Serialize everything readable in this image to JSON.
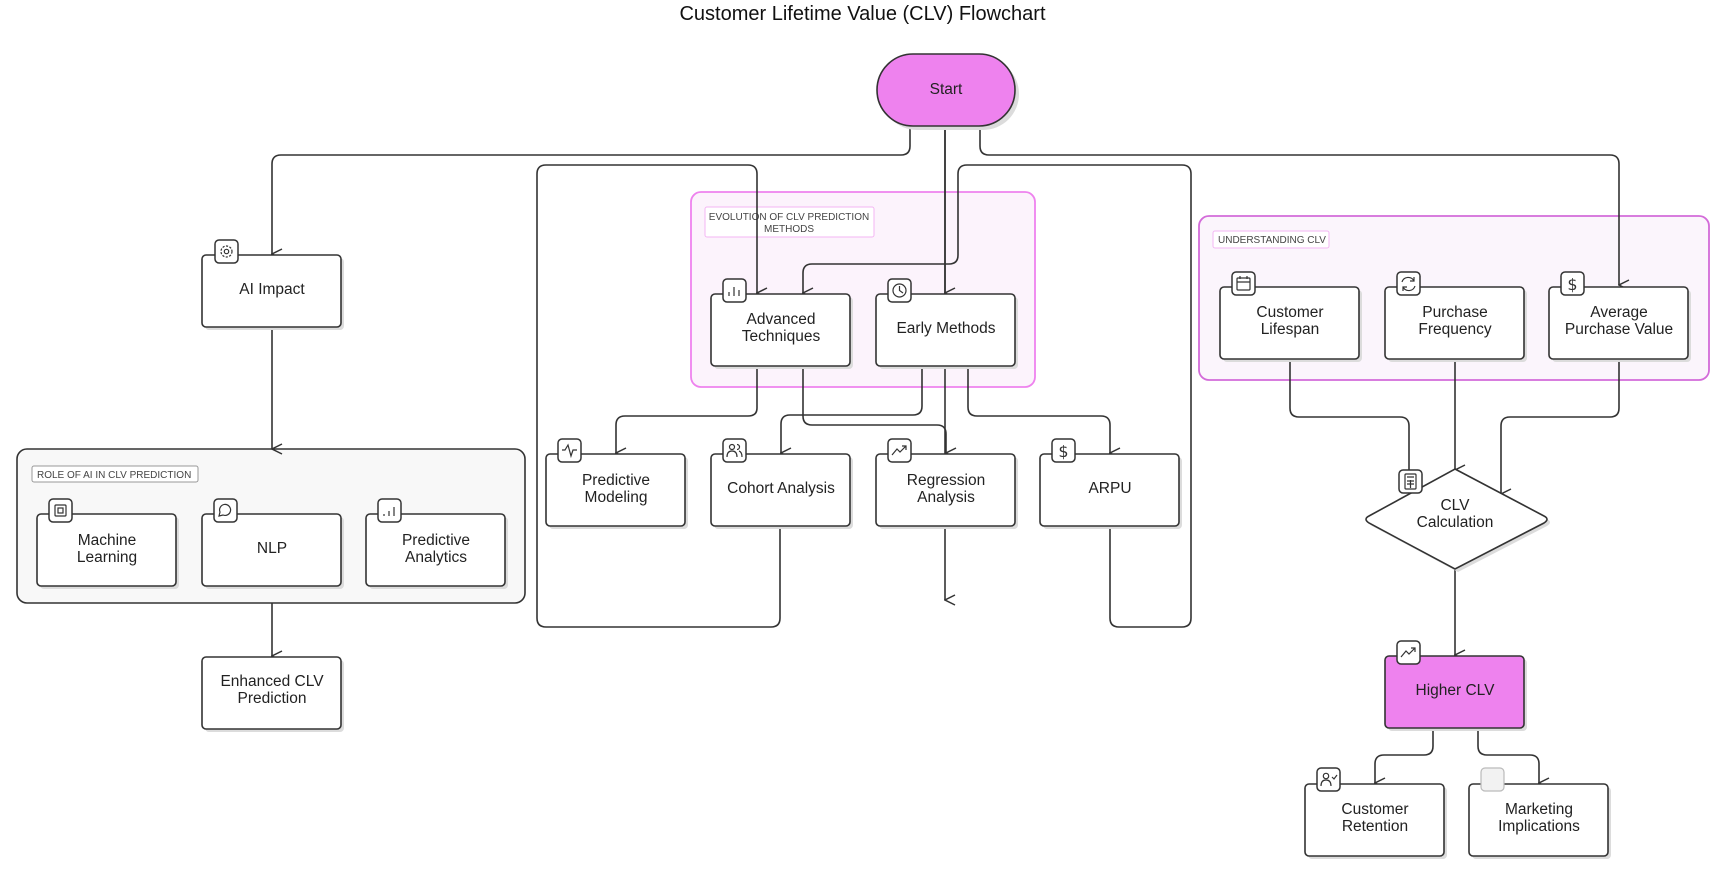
{
  "title": "Customer Lifetime Value (CLV) Flowchart",
  "colors": {
    "highlight": "#ee82ee",
    "group_border_pink": "#ee82ee",
    "group_fill_pink": "#fcf3fc",
    "stroke": "#333333"
  },
  "groups": {
    "role_of_ai": {
      "label": "ROLE OF AI IN CLV PREDICTION"
    },
    "evolution": {
      "label_line1": "EVOLUTION OF CLV PREDICTION",
      "label_line2": "METHODS"
    },
    "understanding": {
      "label": "UNDERSTANDING CLV"
    }
  },
  "nodes": {
    "start": {
      "label": "Start"
    },
    "ai_impact": {
      "label": "AI Impact",
      "icon": "gear-icon"
    },
    "machine_learning": {
      "line1": "Machine",
      "line2": "Learning",
      "icon": "cpu-icon"
    },
    "nlp": {
      "label": "NLP",
      "icon": "chat-bubble-icon"
    },
    "predictive_analytics": {
      "line1": "Predictive",
      "line2": "Analytics",
      "icon": "bar-chart-icon"
    },
    "enhanced_clv": {
      "line1": "Enhanced CLV",
      "line2": "Prediction"
    },
    "advanced_techniques": {
      "line1": "Advanced",
      "line2": "Techniques",
      "icon": "bar-chart-icon"
    },
    "early_methods": {
      "label": "Early Methods",
      "icon": "clock-icon"
    },
    "predictive_modeling": {
      "line1": "Predictive",
      "line2": "Modeling",
      "icon": "activity-icon"
    },
    "cohort_analysis": {
      "label": "Cohort Analysis",
      "icon": "users-icon"
    },
    "regression_analysis": {
      "line1": "Regression",
      "line2": "Analysis",
      "icon": "trending-up-icon"
    },
    "arpu": {
      "label": "ARPU",
      "icon": "dollar-icon"
    },
    "customer_lifespan": {
      "line1": "Customer",
      "line2": "Lifespan",
      "icon": "calendar-icon"
    },
    "purchase_frequency": {
      "line1": "Purchase",
      "line2": "Frequency",
      "icon": "refresh-icon"
    },
    "average_purchase_value": {
      "line1": "Average",
      "line2": "Purchase Value",
      "icon": "dollar-icon"
    },
    "clv_calculation": {
      "line1": "CLV",
      "line2": "Calculation",
      "icon": "calculator-icon"
    },
    "higher_clv": {
      "label": "Higher CLV",
      "icon": "trending-up-icon"
    },
    "customer_retention": {
      "line1": "Customer",
      "line2": "Retention",
      "icon": "user-check-icon"
    },
    "marketing_implications": {
      "line1": "Marketing",
      "line2": "Implications",
      "icon": "blank-icon"
    }
  },
  "edges": [
    {
      "from": "start",
      "to": "ai_impact"
    },
    {
      "from": "start",
      "to": "advanced_techniques"
    },
    {
      "from": "start",
      "to": "early_methods"
    },
    {
      "from": "start",
      "to": "average_purchase_value"
    },
    {
      "from": "ai_impact",
      "to": "role_of_ai"
    },
    {
      "from": "role_of_ai",
      "to": "enhanced_clv"
    },
    {
      "from": "early_methods",
      "to": "advanced_techniques"
    },
    {
      "from": "advanced_techniques",
      "to": "predictive_modeling"
    },
    {
      "from": "advanced_techniques",
      "to": "regression_analysis"
    },
    {
      "from": "early_methods",
      "to": "cohort_analysis"
    },
    {
      "from": "early_methods",
      "to": "arpu"
    },
    {
      "from": "cohort_analysis",
      "to": "advanced_techniques"
    },
    {
      "from": "arpu",
      "to": "early_methods"
    },
    {
      "from": "customer_lifespan",
      "to": "clv_calculation"
    },
    {
      "from": "purchase_frequency",
      "to": "clv_calculation"
    },
    {
      "from": "average_purchase_value",
      "to": "clv_calculation"
    },
    {
      "from": "clv_calculation",
      "to": "higher_clv"
    },
    {
      "from": "higher_clv",
      "to": "customer_retention"
    },
    {
      "from": "higher_clv",
      "to": "marketing_implications"
    }
  ]
}
